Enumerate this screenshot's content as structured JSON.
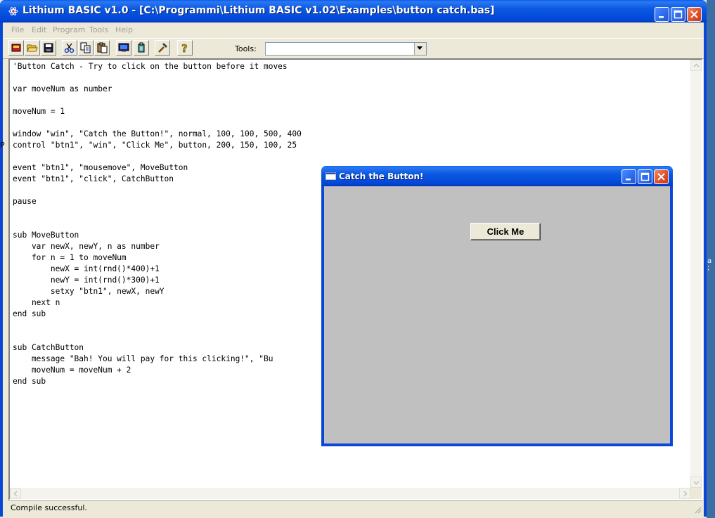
{
  "window": {
    "title": "Lithium BASIC v1.0 - [C:\\Programmi\\Lithium BASIC v1.02\\Examples\\button catch.bas]"
  },
  "menu": {
    "items": [
      {
        "label": "File"
      },
      {
        "label": "Edit"
      },
      {
        "label": "Program"
      },
      {
        "label": "Tools"
      },
      {
        "label": "Help"
      }
    ]
  },
  "toolbar": {
    "tools_label": "Tools:",
    "tools_value": "",
    "buttons": [
      "new-icon",
      "open-icon",
      "save-icon",
      "cut-icon",
      "copy-icon",
      "paste-icon",
      "run-window-icon",
      "compile-icon",
      "build-hammer-icon",
      "help-icon"
    ]
  },
  "editor": {
    "code": "'Button Catch - Try to click on the button before it moves\n\nvar moveNum as number\n\nmoveNum = 1\n\nwindow \"win\", \"Catch the Button!\", normal, 100, 100, 500, 400\ncontrol \"btn1\", \"win\", \"Click Me\", button, 200, 150, 100, 25\n\nevent \"btn1\", \"mousemove\", MoveButton\nevent \"btn1\", \"click\", CatchButton\n\npause\n\n\nsub MoveButton\n    var newX, newY, n as number\n    for n = 1 to moveNum\n        newX = int(rnd()*400)+1\n        newY = int(rnd()*300)+1\n        setxy \"btn1\", newX, newY\n    next n\nend sub\n\n\nsub CatchButton\n    message \"Bah! You will pay for this clicking!\", \"Bu\n    moveNum = moveNum + 2\nend sub"
  },
  "status": {
    "text": "Compile successful."
  },
  "child_window": {
    "title": "Catch the Button!",
    "button_label": "Click Me"
  },
  "desktop_edge": {
    "left_char": "P",
    "right_chars": "a\n;"
  }
}
